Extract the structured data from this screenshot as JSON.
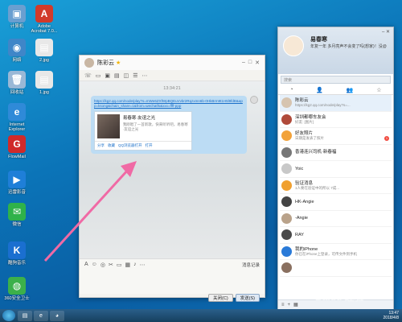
{
  "desktop": {
    "icons": [
      {
        "label": "计算机",
        "glyph": "▣",
        "color": "#6a9fd0"
      },
      {
        "label": "Adobe Acrobat 7.0...",
        "glyph": "A",
        "color": "#d23a2a"
      },
      {
        "label": "网络",
        "glyph": "◉",
        "color": "#3f86c8"
      },
      {
        "label": "2.jpg",
        "glyph": "▤",
        "color": "#e8e8e8"
      },
      {
        "label": "回收站",
        "glyph": "🗑",
        "color": "#9ab8d6"
      },
      {
        "label": "1.jpg",
        "glyph": "▤",
        "color": "#e8e8e8"
      },
      {
        "label": "Internet Explorer",
        "glyph": "e",
        "color": "#2f8ad8"
      },
      {
        "label": "FlowMail",
        "glyph": "G",
        "color": "#d02a2a"
      },
      {
        "label": "迅雷影音",
        "glyph": "▶",
        "color": "#1f7fd8"
      },
      {
        "label": "微信",
        "glyph": "✉",
        "color": "#2fb24a"
      },
      {
        "label": "酷狗音乐",
        "glyph": "K",
        "color": "#1a6fd0"
      },
      {
        "label": "360安全卫士",
        "glyph": "◍",
        "color": "#3cb04a"
      }
    ]
  },
  "chat": {
    "contact_name": "陈彩云",
    "timestamp": "13:34:21",
    "link_text": "https://kg2.qq.com/node/play?s=mWe6ZXfWpBQEuVvbr2Rqzxmn6b-0HkBrm9t1H5l9fdB&app=ksong&chain_share=1&from=wechatfs&xxx=ffff-ppp",
    "card": {
      "title": "易春寒·友谊之光",
      "desc": "我刚唱了一首新歌，快来听听吧。易春寒·友谊之光",
      "actions": [
        "分享",
        "收藏",
        "QQ浏览器打开",
        "打开"
      ]
    },
    "msg_record_label": "消息记录",
    "close_label": "关闭(C)",
    "send_label": "发送(S)"
  },
  "qq": {
    "nickname": "易春寒",
    "signature": "年复一年 多月亮声不会变了吗(想家)！没@",
    "search_placeholder": "搜索",
    "contacts": [
      {
        "name": "陈彩云",
        "preview": "https://kg2.qq.com/node/play?s=...",
        "time": "",
        "color": "#d6c4b0",
        "badge": ""
      },
      {
        "name": "深圳都哪车友会",
        "preview": "好友: [图片]",
        "time": "",
        "color": "#b04a3a",
        "badge": ""
      },
      {
        "name": "好友照片",
        "preview": "日期是发表了照片",
        "time": "",
        "color": "#f2a23a",
        "badge": "1"
      },
      {
        "name": "香港连兴司机·新春福",
        "preview": "",
        "time": "",
        "color": "#777",
        "badge": ""
      },
      {
        "name": "Yoic",
        "preview": "",
        "time": "",
        "color": "#c8c8c8",
        "badge": ""
      },
      {
        "name": "验证消息",
        "preview": "1人要在验证中的所以 7成...",
        "time": "",
        "color": "#f0a030",
        "badge": ""
      },
      {
        "name": "HK-Angie",
        "preview": "",
        "time": "",
        "color": "#444",
        "badge": ""
      },
      {
        "name": "-Angie",
        "preview": "",
        "time": "",
        "color": "#b9a28a",
        "badge": ""
      },
      {
        "name": "RAY",
        "preview": "",
        "time": "",
        "color": "#4a4a4a",
        "badge": ""
      },
      {
        "name": "我的iPhone",
        "preview": "你已在iPhone上登录，可传文件到手机",
        "time": "",
        "color": "#2a7ad8",
        "badge": ""
      },
      {
        "name": "",
        "preview": "",
        "time": "",
        "color": "#8a7060",
        "badge": ""
      }
    ]
  },
  "taskbar": {
    "time": "13:47",
    "date": "2018/4/8"
  },
  "watermark": "Baidu 经验"
}
